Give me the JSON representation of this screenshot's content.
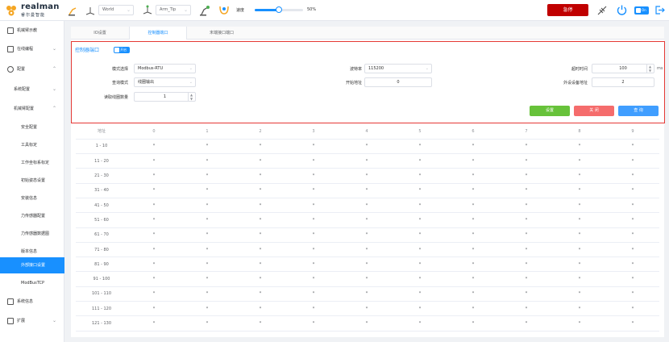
{
  "brand": {
    "name": "realman",
    "sub": "睿尔曼智能",
    "colors": {
      "accent": "#1890ff",
      "orange": "#f5a623",
      "danger": "#c00000",
      "highlight": "#e53935"
    }
  },
  "header": {
    "frame_select": "World",
    "tool_select": "Arm_Tip",
    "speed_label": "速度",
    "speed_value": "50%",
    "speed_fraction": 0.5,
    "estop_label": "急停",
    "mode_toggle_label": "On"
  },
  "sidebar": {
    "items": [
      {
        "label": "机械臂示教",
        "icon": "robot-arm-icon"
      },
      {
        "label": "在线编程",
        "icon": "code-icon"
      },
      {
        "label": "配置",
        "icon": "gear-icon"
      },
      {
        "label": "系统配置"
      },
      {
        "label": "机械臂配置"
      },
      {
        "label": "安全配置"
      },
      {
        "label": "工具标定"
      },
      {
        "label": "工作坐标系标定"
      },
      {
        "label": "初始姿态设置"
      },
      {
        "label": "安装信息"
      },
      {
        "label": "力传感器配置"
      },
      {
        "label": "力传感器数据图"
      },
      {
        "label": "版本信息"
      },
      {
        "label": "外部接口设置"
      },
      {
        "label": "ModBusTCP"
      },
      {
        "label": "系统信息",
        "icon": "monitor-icon"
      },
      {
        "label": "扩展",
        "icon": "extension-icon"
      }
    ]
  },
  "tabs": [
    "IO设置",
    "控制器端口",
    "末端接口端口"
  ],
  "panel": {
    "title": "控制器端口",
    "toggle_label": "开启",
    "fields": {
      "mode_label": "模式选择",
      "mode_value": "Modbus-RTU",
      "baud_label": "波特率",
      "baud_value": "115200",
      "timeout_label": "超时时间",
      "timeout_value": "100",
      "timeout_unit": "ms",
      "query_label": "查询模式",
      "query_value": "线圈输出",
      "start_label": "开始地址",
      "start_value": "0",
      "device_label": "外设设备地址",
      "device_value": "2",
      "count_label": "读取线圈数量",
      "count_value": "1"
    },
    "buttons": {
      "set": "设置",
      "close": "关 闭",
      "query": "查 询"
    }
  },
  "table": {
    "address_header": "地址",
    "columns": [
      "0",
      "1",
      "2",
      "3",
      "4",
      "5",
      "6",
      "7",
      "8",
      "9"
    ],
    "rows": [
      "1 - 10",
      "11 - 20",
      "21 - 30",
      "31 - 40",
      "41 - 50",
      "51 - 60",
      "61 - 70",
      "71 - 80",
      "81 - 90",
      "91 - 100",
      "101 - 110",
      "111 - 120",
      "121 - 130"
    ],
    "cell_value": "*"
  }
}
